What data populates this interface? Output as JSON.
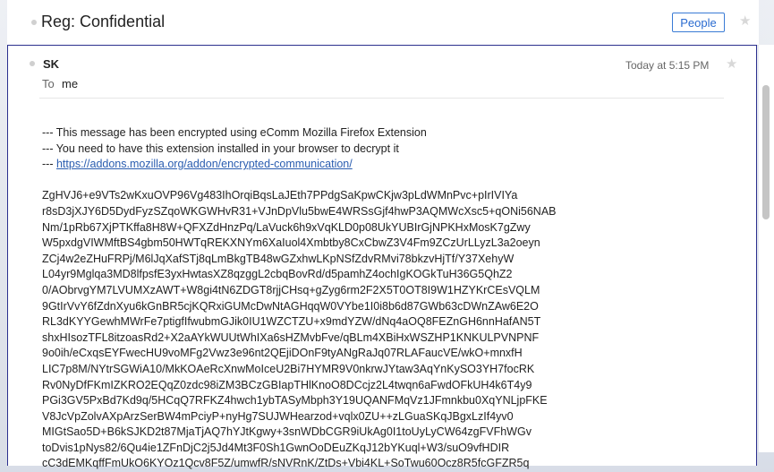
{
  "header": {
    "subject": "Reg: Confidential",
    "people_label": "People",
    "star_glyph": "★"
  },
  "message": {
    "sender": "SK",
    "timestamp": "Today at 5:15 PM",
    "star_glyph": "★",
    "to_label": "To",
    "to_value": "me",
    "notice": {
      "line1": "--- This message has been encrypted using eComm Mozilla Firefox Extension",
      "line2": "--- You need to have this extension installed in your browser to decrypt it",
      "line3_prefix": "---",
      "link": "https://addons.mozilla.org/addon/encrypted-communication/"
    },
    "cipher_lines": [
      "ZgHVJ6+e9VTs2wKxuOVP96Vg483IhOrqiBqsLaJEth7PPdgSaKpwCKjw3pLdWMnPvc+pIrIVIYa",
      "r8sD3jXJY6D5DydFyzSZqoWKGWHvR31+VJnDpVlu5bwE4WRSsGjf4hwP3AQMWcXsc5+qONi56NAB",
      "Nm/1pRb67XjPTKffa8H8W+QFXZdHnzPq/LaVuck6h9xVqKLD0p08UkYUBIrGjNPKHxMosK7gZwy",
      "W5pxdgVIWMftBS4gbm50HWTqREKXNYm6XaIuol4Xmbtby8CxCbwZ3V4Fm9ZCzUrLLyzL3a2oeyn",
      "ZCj4w2eZHuFRPj/M6lJqXafSTj8qLmBkgTB48wGZxhwLKpNSfZdvRMvi78bkzvHjTf/Y37XehyW",
      "L04yr9Mglqa3MD8lfpsfE3yxHwtasXZ8qzggL2cbqBovRd/d5pamhZ4ochIgKOGkTuH36G5QhZ2",
      "0/AObrvgYM7LVUMXzAWT+W8gi4tN6ZDGT8rjjCHsq+gZyg6rm2F2X5T0OT8I9W1HZYKrCEsVQLM",
      "9GtIrVvY6fZdnXyu6kGnBR5cjKQRxiGUMcDwNtAGHqqW0VYbe1I0i8b6d87GWb63cDWnZAw6E2O",
      "RL3dKYYGewhMWrFe7ptigfIfwubmGJik0IU1WZCTZU+x9mdYZW/dNq4aOQ8FEZnGH6nnHafAN5T",
      "shxHIsozTFL8itzoasRd2+X2aAYkWUUtWhIXa6sHZMvbFve/qBLm4XBiHxWSZHP1KNKULPVNPNF",
      "9o0ih/eCxqsEYFwecHU9voMFg2Vwz3e96nt2QEjiDOnF9tyANgRaJq07RLAFaucVE/wkO+mnxfH",
      "LIC7p8M/NYtrSGWiA10/MkKOAeRcXnwMoIceU2Bi7HYMR9V0nkrwJYtaw3AqYnKySO3YH7focRK",
      "Rv0NyDfFKmIZKRO2EQqZ0zdc98iZM3BCzGBIapTHlKnoO8DCcjz2L4twqn6aFwdOFkUH4k6T4y9",
      "PGi3GV5PxBd7Kd9q/5HCqQ7RFKZ4hwch1ybTASyMbph3Y19UQANFMqVz1JFmnkbu0XqYNLjpFKE",
      "V8JcVpZolvAXpArzSerBW4mPciyP+nyHg7SUJWHearzod+vqlx0ZU++zLGuaSKqJBgxLzIf4yv0",
      "MIGtSao5D+B6kSJKD2t87MjaTjAQ7hYJtKgwy+3snWDbCGR9iUkAg0I1toUyLyCW64zgFVFhWGv",
      "toDvis1pNys82/6Qu4ie1ZFnDjC2j5Jd4Mt3F0Sh1GwnOoDEuZKqJ12bYKuql+W3/suO9vfHDIR",
      "cC3dEMKqffFmUkO6KYOz1Qcv8F5Z/umwfR/sNVRnK/ZtDs+Vbi4KL+SoTwu60Ocz8R5fcGFZR5q"
    ]
  }
}
